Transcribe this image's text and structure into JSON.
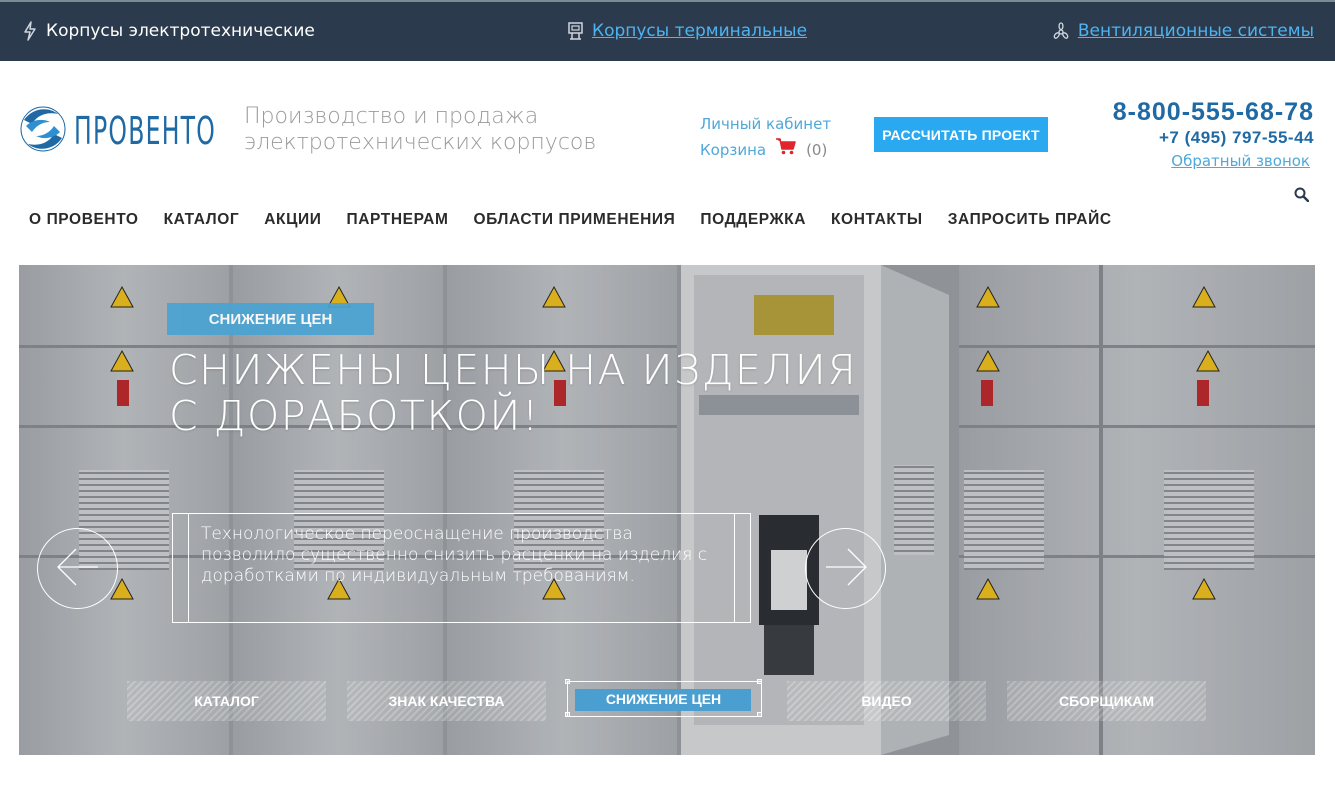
{
  "topbar": {
    "links": [
      {
        "label": "Корпусы электротехнические",
        "icon": "lightning-icon"
      },
      {
        "label": "Корпусы терминальные",
        "icon": "terminal-icon"
      },
      {
        "label": "Вентиляционные системы",
        "icon": "fan-icon"
      }
    ]
  },
  "header": {
    "logo_text": "ПРОВЕНТО",
    "tagline_line1": "Производство и продажа",
    "tagline_line2": "электротехнических корпусов",
    "account_label": "Личный кабинет",
    "cart_label": "Корзина",
    "cart_count": "(0)",
    "calc_button": "РАССЧИТАТЬ ПРОЕКТ",
    "phone_main": "8-800-555-68-78",
    "phone_second": "+7 (495) 797-55-44",
    "callback_label": "Обратный звонок"
  },
  "nav": {
    "items": [
      "О ПРОВЕНТО",
      "КАТАЛОГ",
      "АКЦИИ",
      "ПАРТНЕРАМ",
      "ОБЛАСТИ ПРИМЕНЕНИЯ",
      "ПОДДЕРЖКА",
      "КОНТАКТЫ",
      "ЗАПРОСИТЬ ПРАЙС"
    ]
  },
  "slider": {
    "tag": "СНИЖЕНИЕ ЦЕН",
    "headline": "СНИЖЕНЫ ЦЕНЫ НА ИЗДЕЛИЯ С ДОРАБОТКОЙ!",
    "description": "Технологическое переоснащение производства позволило существенно снизить расценки на изделия с доработками по индивидуальным требованиям.",
    "tabs": [
      "КАТАЛОГ",
      "ЗНАК КАЧЕСТВА",
      "СНИЖЕНИЕ ЦЕН",
      "ВИДЕО",
      "СБОРЩИКАМ"
    ],
    "active_tab": "СНИЖЕНИЕ ЦЕН"
  },
  "colors": {
    "topbar_bg": "#2b3a4c",
    "brand_blue": "#1f6aa5",
    "accent_blue": "#2aa9f0",
    "link_blue": "#4fb3f0"
  }
}
